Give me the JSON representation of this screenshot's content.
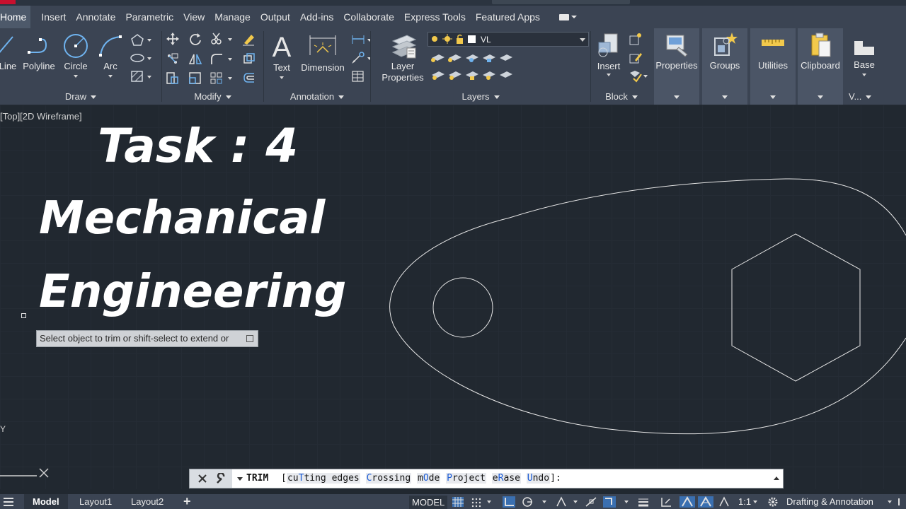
{
  "menu": {
    "tabs": [
      "Home",
      "Insert",
      "Annotate",
      "Parametric",
      "View",
      "Manage",
      "Output",
      "Add-ins",
      "Collaborate",
      "Express Tools",
      "Featured Apps"
    ]
  },
  "ribbon": {
    "draw": {
      "title": "Draw",
      "line": "Line",
      "polyline": "Polyline",
      "circle": "Circle",
      "arc": "Arc"
    },
    "modify": {
      "title": "Modify"
    },
    "annotation": {
      "title": "Annotation",
      "text": "Text",
      "dimension": "Dimension"
    },
    "layers": {
      "title": "Layers",
      "layer_properties_1": "Layer",
      "layer_properties_2": "Properties",
      "current_layer": "VL"
    },
    "block": {
      "title": "Block",
      "insert": "Insert"
    },
    "properties": "Properties",
    "groups": "Groups",
    "utilities": "Utilities",
    "clipboard": "Clipboard",
    "base": "Base",
    "view_short": "V..."
  },
  "viewport": {
    "view_label": "[Top][2D Wireframe]",
    "overlay_line1": "Task : 4",
    "overlay_line2": "Mechanical",
    "overlay_line3": "Engineering",
    "tooltip": "Select object to trim or shift-select to extend or",
    "ucs_y": "Y"
  },
  "command_line": {
    "command": "TRIM",
    "options": [
      {
        "pre": "cu",
        "key": "T",
        "post": "ting edges"
      },
      {
        "pre": "",
        "key": "C",
        "post": "rossing"
      },
      {
        "pre": "m",
        "key": "O",
        "post": "de"
      },
      {
        "pre": "",
        "key": "P",
        "post": "roject"
      },
      {
        "pre": "e",
        "key": "R",
        "post": "ase"
      },
      {
        "pre": "",
        "key": "U",
        "post": "ndo"
      }
    ],
    "open_bracket": "[",
    "close": "]:"
  },
  "status_bar": {
    "model_tab": "Model",
    "layout1": "Layout1",
    "layout2": "Layout2",
    "add_layout": "+",
    "model_button": "MODEL",
    "scale": "1:1",
    "workspace": "Drafting & Annotation"
  },
  "colors": {
    "background": "#212830",
    "ribbon": "#3b4453",
    "geometry": "#e6e6e6",
    "option_key": "#1a5bd6"
  }
}
